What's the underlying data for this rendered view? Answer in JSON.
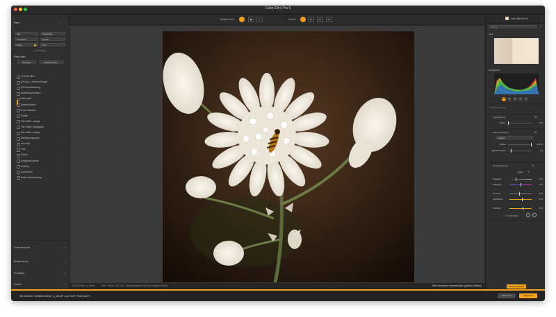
{
  "window": {
    "title": "Color Efex Pro 6"
  },
  "left_panel": {
    "filter_header": "Filter",
    "fields": [
      {
        "label": "Alle",
        "checked": false
      },
      {
        "label": "Verwendet",
        "checked": false
      },
      {
        "label": "Architektur",
        "checked": false
      },
      {
        "label": "Details",
        "checked": false
      },
      {
        "label": "Farbe",
        "checked": true
      },
      {
        "label": "Film",
        "checked": false
      }
    ],
    "show_all": "Alle anzeigen",
    "filter_list_header": "Filter-Liste",
    "favorites_button": "Favoriten",
    "new_preset_button": "Zuletzt verwe...",
    "filters": [
      "60-Grad-Filter",
      "60 Grad – Verrauschungen",
      "ASV-Kontrastierung",
      "Aufhellung/Schatten",
      "Bildmodell",
      "Detailextraktion",
      "Colore Balance",
      "Details",
      "Film Effekt: Vintage",
      "Film Effekt: Nostalgisch",
      "Film Effekt: Vintage",
      "Modellierungstools",
      "Monoday",
      "Pola",
      "Pastell",
      "Helligkeit/Kontrast",
      "Aufheller",
      "Sonnenlicht",
      "Weiß-Neutralisierung"
    ],
    "bottom_sections": [
      "Vorlandbeispiele",
      "Stromkontrolle",
      "Presetfilter",
      "Verlauf"
    ]
  },
  "toolbar": {
    "compare_label": "Vergleichen",
    "zoom_label": "Zoom",
    "zoom_fit": "Fit",
    "zoom_100": "1:1",
    "zoom_custom": "4:1"
  },
  "status": {
    "filename": "220819-0019_1_NA.tif",
    "info": "8 bit · 96 dpi · ISO 100 · Gesamtansicht: ProPhoto Farbprofil sRGB",
    "notice": "Nicht destruktive Bearbeitungen (größere Dateien)"
  },
  "right_panel": {
    "preset_name": "Color Efex Pro 6",
    "search_placeholder": "Suchen",
    "loupe_header": "Lupe",
    "histogram_header": "Histogramm",
    "channel_buttons": [
      "RGB",
      "R",
      "G",
      "B",
      "L"
    ],
    "sections": [
      {
        "title": "Tonwert/Kontrast",
        "open": false
      },
      {
        "title": "Vignettierung",
        "open": true
      }
    ],
    "vignette": {
      "label": "Stärke",
      "value": "0 %"
    },
    "blur_section": "Weichzeichnung",
    "blur_mode": "Original",
    "blur_strength_label": "Stärke",
    "blur_strength_value": "100 %",
    "blur_size_label": "Vignettengröße",
    "blur_size_value": "1.0",
    "tonal_section": "Tonwertkorrektur",
    "tonal_preset": "Farbe",
    "tonal_rows": [
      {
        "label": "Helligkeit",
        "value": "0 %",
        "level": 0.28
      },
      {
        "label": "Sättigung",
        "value": "0 %",
        "level": 0.5
      },
      {
        "label": "Kontrast",
        "value": "0 %",
        "level": 0.45
      },
      {
        "label": "Spitzlichter",
        "value": "0 %",
        "level": 0.55
      },
      {
        "label": "Schatten",
        "value": "0 %",
        "level": 0.6
      }
    ],
    "control_points_label": "Kontrollpunkte",
    "apply_button": "Preset speichern"
  },
  "bottom_bar": {
    "message": "Sie ändern \"220819-0019_1_NA.tif\" von DxO PhotoLab 5",
    "cancel_button": "Abbrechen",
    "save_button": "Speichern"
  },
  "colors": {
    "accent": "#f0a01a",
    "panel_bg": "#2f2f2f",
    "canvas_bg": "#3a3a3a",
    "photo_bg": "#2a1d14"
  }
}
